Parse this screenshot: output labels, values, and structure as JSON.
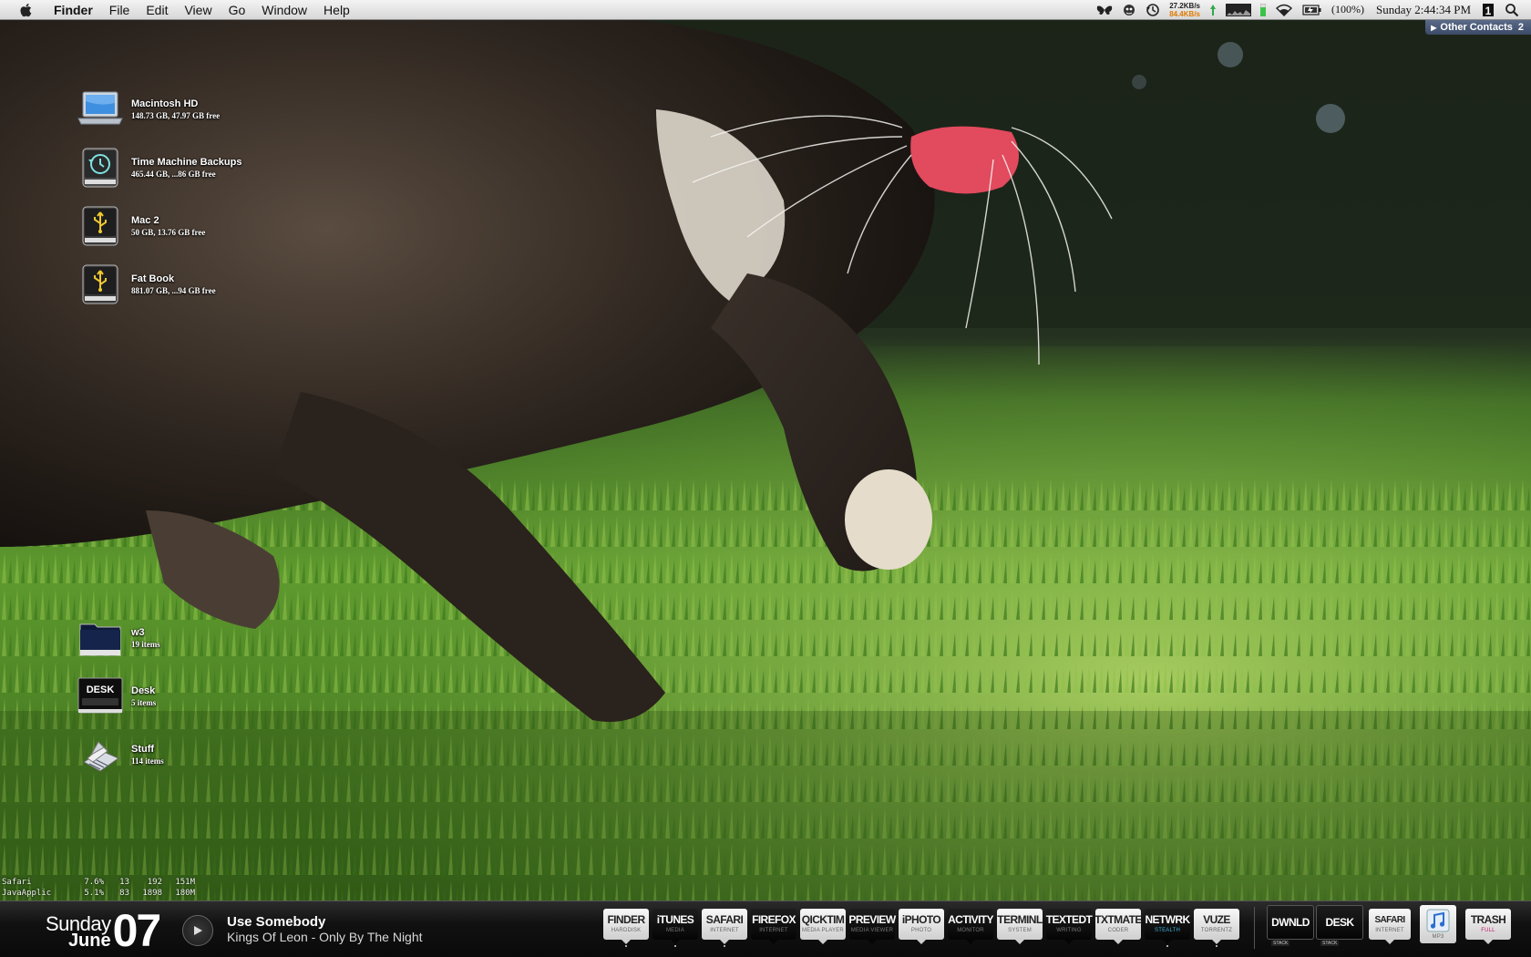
{
  "menubar": {
    "app_name": "Finder",
    "menus": [
      "File",
      "Edit",
      "View",
      "Go",
      "Window",
      "Help"
    ],
    "network": {
      "up": "27.2KB/s",
      "down": "84.4KB/s"
    },
    "battery": "(100%)",
    "clock": "Sunday 2:44:34 PM"
  },
  "contacts_tab": {
    "label": "Other Contacts",
    "count": "2"
  },
  "desktop": {
    "volumes": [
      {
        "name": "Macintosh HD",
        "info": "148.73 GB, 47.97 GB free",
        "icon": "laptop-drive-icon"
      },
      {
        "name": "Time Machine Backups",
        "info": "465.44 GB, ...86 GB free",
        "icon": "time-machine-drive-icon"
      },
      {
        "name": "Mac 2",
        "info": "50 GB, 13.76 GB free",
        "icon": "usb-drive-icon"
      },
      {
        "name": "Fat Book",
        "info": "881.07 GB, ...94 GB free",
        "icon": "usb-drive-icon"
      }
    ],
    "folders": [
      {
        "name": "w3",
        "info": "19 items",
        "icon": "folder-dark-icon"
      },
      {
        "name": "Desk",
        "info": "5 items",
        "icon": "desk-stack-icon",
        "badge": "DESK"
      },
      {
        "name": "Stuff",
        "info": "114 items",
        "icon": "stuff-folder-icon"
      }
    ]
  },
  "process_monitor": [
    {
      "name": "Safari",
      "cpu": "7.6%",
      "threads": "13",
      "ports": "192",
      "mem": "151M"
    },
    {
      "name": "JavaApplic",
      "cpu": "5.1%",
      "threads": "83",
      "ports": "1898",
      "mem": "180M"
    }
  ],
  "date_widget": {
    "weekday": "Sunday",
    "month": "June",
    "day": "07"
  },
  "now_playing": {
    "song": "Use Somebody",
    "artist": "Kings Of Leon - Only By The Night"
  },
  "dock": {
    "apps": [
      {
        "label": "FINDER",
        "sub": "HARDDISK",
        "style": "light",
        "running": true
      },
      {
        "label": "iTUNES",
        "sub": "MEDIA",
        "style": "dark",
        "running": true
      },
      {
        "label": "SAFARI",
        "sub": "INTERNET",
        "style": "light",
        "running": true
      },
      {
        "label": "FIREFOX",
        "sub": "INTERNET",
        "style": "dark",
        "running": false
      },
      {
        "label": "QICKTIM",
        "sub": "MEDIA PLAYER",
        "style": "light",
        "running": false
      },
      {
        "label": "PREVIEW",
        "sub": "MEDIA VIEWER",
        "style": "dark",
        "running": false
      },
      {
        "label": "iPHOTO",
        "sub": "PHOTO",
        "style": "light",
        "running": false
      },
      {
        "label": "ACTIVITY",
        "sub": "MONITOR",
        "style": "dark",
        "running": false
      },
      {
        "label": "TERMINL",
        "sub": "SYSTEM",
        "style": "light",
        "running": false
      },
      {
        "label": "TEXTEDT",
        "sub": "WRITING",
        "style": "dark",
        "running": false
      },
      {
        "label": "TXTMATE",
        "sub": "CODER",
        "style": "light",
        "running": false
      },
      {
        "label": "NETWRK",
        "sub": "STEALTH",
        "style": "dark",
        "running": true
      },
      {
        "label": "VUZE",
        "sub": "TORRENTZ",
        "style": "light",
        "running": true
      }
    ],
    "stacks": [
      {
        "label": "DWNLD",
        "tag": "STACK",
        "style": "dark"
      },
      {
        "label": "DESK",
        "tag": "STACK",
        "style": "dark"
      },
      {
        "label": "SAFARI",
        "sub": "INTERNET",
        "style": "light"
      },
      {
        "label": "",
        "sub": "MP3",
        "style": "light",
        "icon": "itunes-music-icon"
      },
      {
        "label": "TRASH",
        "sub": "FULL",
        "style": "light"
      }
    ]
  },
  "colors": {
    "menubar": "#e5e5e5",
    "dock": "#111111",
    "accent_orange": "#e07a00",
    "contacts_tab": "#4a5a78"
  }
}
